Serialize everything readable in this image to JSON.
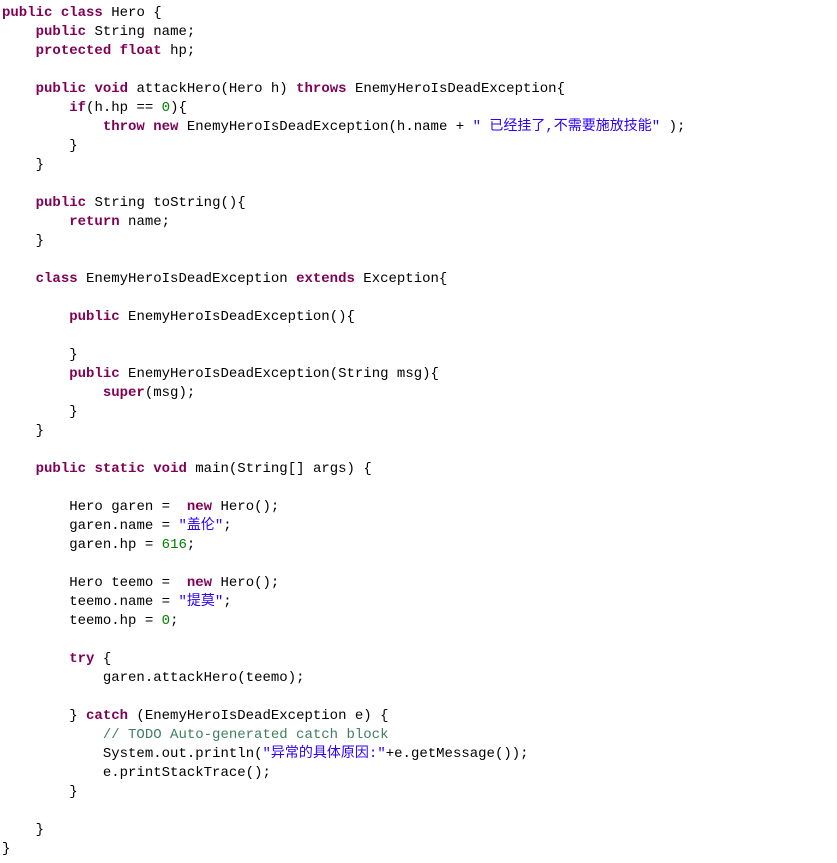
{
  "code": {
    "language": "java",
    "class_name": "Hero",
    "fields": [
      {
        "modifier": "public",
        "type": "String",
        "name": "name"
      },
      {
        "modifier": "protected",
        "type": "float",
        "name": "hp"
      }
    ],
    "methods": [
      {
        "signature": "public void attackHero(Hero h) throws EnemyHeroIsDeadException"
      },
      {
        "signature": "public String toString()"
      },
      {
        "signature": "public static void main(String[] args)"
      }
    ],
    "inner_class": "EnemyHeroIsDeadException",
    "literals": {
      "zero": "0",
      "hp_value": "616",
      "throw_msg": " 已经挂了,不需要施放技能",
      "str_garen": "盖伦",
      "str_teemo": "提莫",
      "print_prefix": "异常的具体原因:",
      "comment_todo": "// TODO Auto-generated catch block"
    },
    "kw": {
      "public": "public",
      "class": "class",
      "protected": "protected",
      "float": "float",
      "void": "void",
      "throws": "throws",
      "if": "if",
      "throw": "throw",
      "new": "new",
      "return": "return",
      "extends": "extends",
      "super": "super",
      "static": "static",
      "try": "try",
      "catch": "catch"
    },
    "ident": {
      "String": "String",
      "Hero": "Hero",
      "name": "name",
      "hp": "hp",
      "attackHero": "attackHero",
      "h": "h",
      "EnemyHeroIsDeadException": "EnemyHeroIsDeadException",
      "toString": "toString",
      "Exception": "Exception",
      "msg": "msg",
      "main": "main",
      "args": "args",
      "garen": "garen",
      "teemo": "teemo",
      "System": "System",
      "out": "out",
      "println": "println",
      "getMessage": "getMessage",
      "printStackTrace": "printStackTrace",
      "e": "e"
    }
  }
}
